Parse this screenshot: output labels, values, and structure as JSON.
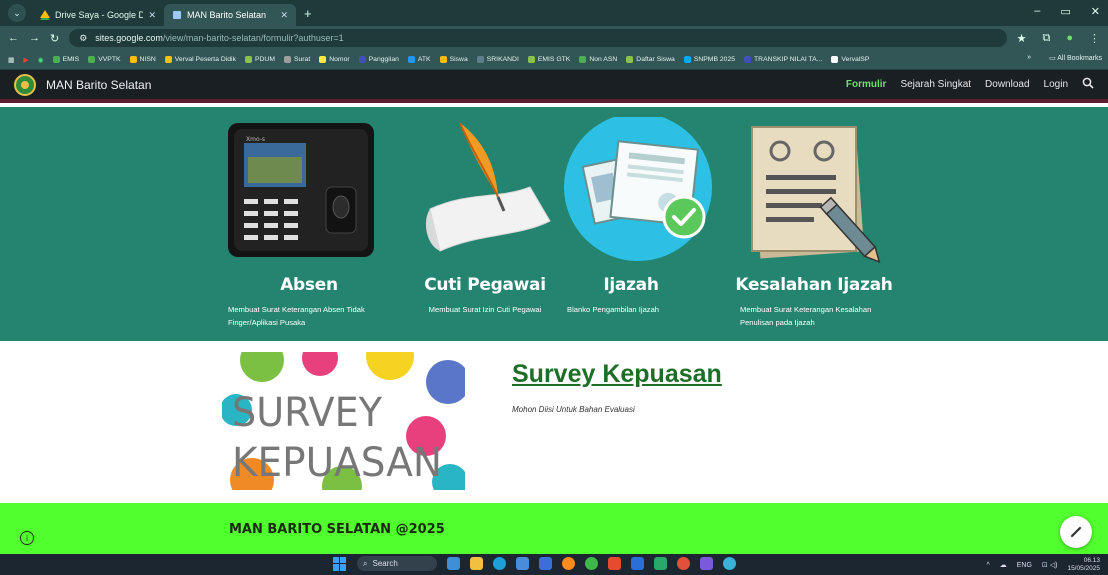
{
  "browser": {
    "tabs": [
      {
        "label": "Drive Saya - Google Drive",
        "color": "#fbbc04",
        "active": false
      },
      {
        "label": "MAN Barito Selatan",
        "color": "#9ec9ff",
        "active": true
      }
    ],
    "url_host": "sites.google.com",
    "url_path": "/view/man-barito-selatan/formulir?authuser=1",
    "bookmarks": [
      {
        "label": "EMIS",
        "color": "#4caf50"
      },
      {
        "label": "VVPTK",
        "color": "#4caf50"
      },
      {
        "label": "NISN",
        "color": "#ffc107"
      },
      {
        "label": "Verval Peserta Didik",
        "color": "#ffc107"
      },
      {
        "label": "PDUM",
        "color": "#8bc34a"
      },
      {
        "label": "Surat",
        "color": "#9e9e9e"
      },
      {
        "label": "Nomor",
        "color": "#ffeb3b"
      },
      {
        "label": "Panggilan",
        "color": "#3f51b5"
      },
      {
        "label": "ATK",
        "color": "#2196f3"
      },
      {
        "label": "Siswa",
        "color": "#fbbc04"
      },
      {
        "label": "SRIKANDI",
        "color": "#607d8b"
      },
      {
        "label": "EMIS GTK",
        "color": "#8bc34a"
      },
      {
        "label": "Non ASN",
        "color": "#4caf50"
      },
      {
        "label": "Daftar Siswa",
        "color": "#8bc34a"
      },
      {
        "label": "SNPMB 2025",
        "color": "#03a9f4"
      },
      {
        "label": "TRANSKIP NILAI TA...",
        "color": "#3f51b5"
      },
      {
        "label": "VervalSP",
        "color": "#ffffff"
      }
    ],
    "all_bookmarks": "All Bookmarks"
  },
  "site": {
    "name": "MAN Barito Selatan",
    "nav": [
      {
        "label": "Formulir",
        "active": true
      },
      {
        "label": "Sejarah Singkat",
        "active": false
      },
      {
        "label": "Download",
        "active": false
      },
      {
        "label": "Login",
        "active": false
      }
    ]
  },
  "cards": [
    {
      "title": "Absen",
      "desc": "Membuat Surat Keterangan Absen Tidak Finger/Aplikasi Pusaka"
    },
    {
      "title": "Cuti Pegawai",
      "desc": "Membuat Surat Izin Cuti Pegawai"
    },
    {
      "title": "Ijazah",
      "desc": "Blanko Pengambilan Ijazah"
    },
    {
      "title": "Kesalahan Ijazah",
      "desc": "Membuat Surat Keterangan Kesalahan Penulisan pada Ijazah"
    }
  ],
  "survey": {
    "image_text_line1": "SURVEY",
    "image_text_line2": "KEPUASAN",
    "title": "Survey Kepuasan",
    "subtitle": "Mohon Diisi Untuk Bahan Evaluasi"
  },
  "footer": {
    "text": "MAN BARITO SELATAN @2025"
  },
  "taskbar": {
    "search_label": "Search",
    "lang": "ENG",
    "time": "06.13",
    "date": "15/05/2025"
  },
  "colors": {
    "teal": "#248470",
    "footer_green": "#52ff2e",
    "survey_link": "#1e6e28"
  }
}
